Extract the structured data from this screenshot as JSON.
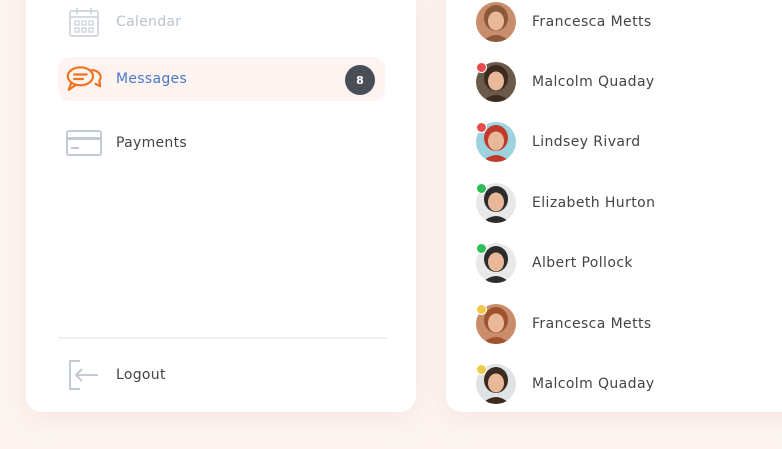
{
  "nav": {
    "calendar_label": "Calendar",
    "messages_label": "Messages",
    "messages_badge": "8",
    "payments_label": "Payments",
    "logout_label": "Logout"
  },
  "contacts": [
    {
      "name": "Francesca Metts",
      "status_color": "",
      "avatar_bg": "#c98d6b",
      "hair": "#8a5a3c"
    },
    {
      "name": "Malcolm Quaday",
      "status_color": "#e84b4b",
      "avatar_bg": "#6b5a4a",
      "hair": "#3c2c20"
    },
    {
      "name": "Lindsey Rivard",
      "status_color": "#e84b4b",
      "avatar_bg": "#9cd3de",
      "hair": "#c0392b"
    },
    {
      "name": "Elizabeth Hurton",
      "status_color": "#2ebd59",
      "avatar_bg": "#e8e8e8",
      "hair": "#2c2c2c"
    },
    {
      "name": "Albert Pollock",
      "status_color": "#2ebd59",
      "avatar_bg": "#e8e8e8",
      "hair": "#2c2c2c"
    },
    {
      "name": "Francesca Metts",
      "status_color": "#f1c94a",
      "avatar_bg": "#c98d6b",
      "hair": "#a0522d"
    },
    {
      "name": "Malcolm Quaday",
      "status_color": "#f1c94a",
      "avatar_bg": "#dfe3e6",
      "hair": "#3c2c20"
    }
  ],
  "colors": {
    "accent": "#4a78c8",
    "messages_icon": "#f0731f",
    "badge_bg": "#4a4f57",
    "icon_gray": "#c3cad1"
  }
}
